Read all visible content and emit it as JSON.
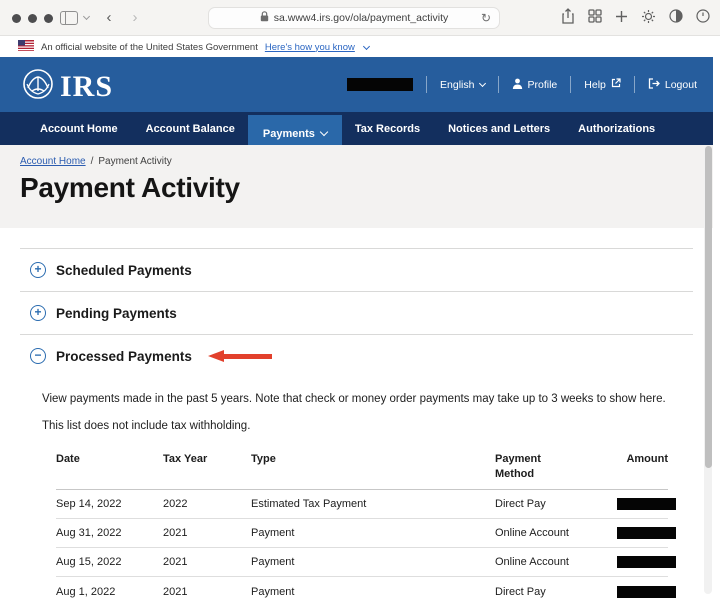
{
  "browser": {
    "url": "sa.www4.irs.gov/ola/payment_activity"
  },
  "gov_banner": {
    "text": "An official website of the United States Government",
    "link_label": "Here's how you know"
  },
  "header": {
    "logo_text": "IRS",
    "language_label": "English",
    "profile_label": "Profile",
    "help_label": "Help",
    "logout_label": "Logout"
  },
  "nav": {
    "active_item": "Payments",
    "items": [
      {
        "label": "Account Home"
      },
      {
        "label": "Account Balance"
      },
      {
        "label": "Payments"
      },
      {
        "label": "Tax Records"
      },
      {
        "label": "Notices and Letters"
      },
      {
        "label": "Authorizations"
      }
    ]
  },
  "breadcrumb": {
    "link": "Account Home",
    "separator": "/",
    "current": "Payment Activity"
  },
  "page": {
    "title": "Payment Activity"
  },
  "accordions": [
    {
      "label": "Scheduled Payments",
      "icon": "+",
      "state": "collapsed"
    },
    {
      "label": "Pending Payments",
      "icon": "+",
      "state": "collapsed"
    },
    {
      "label": "Processed Payments",
      "icon": "−",
      "state": "expanded"
    }
  ],
  "annotation": {
    "type": "red-arrow",
    "points_at": "Processed Payments"
  },
  "processed": {
    "description": "View payments made in the past 5 years. Note that check or money order payments may take up to 3 weeks to show here.",
    "note": "This list does not include tax withholding.",
    "table": {
      "columns": {
        "date": "Date",
        "tax_year": "Tax Year",
        "type": "Type",
        "method": "Payment Method",
        "amount": "Amount"
      },
      "rows": [
        {
          "date": "Sep 14, 2022",
          "tax_year": "2022",
          "type": "Estimated Tax Payment",
          "method": "Direct Pay",
          "amount_redacted": true
        },
        {
          "date": "Aug 31, 2022",
          "tax_year": "2021",
          "type": "Payment",
          "method": "Online Account",
          "amount_redacted": true
        },
        {
          "date": "Aug 15, 2022",
          "tax_year": "2021",
          "type": "Payment",
          "method": "Online Account",
          "amount_redacted": true
        },
        {
          "date": "Aug 1, 2022",
          "tax_year": "2021",
          "type": "Payment",
          "method": "Direct Pay",
          "amount_redacted": true
        }
      ]
    }
  },
  "colors": {
    "header_blue": "#265d9d",
    "nav_navy": "#132f5e",
    "active_tab_blue": "#2a68a9",
    "link_blue": "#2b5cb0",
    "accent_red": "#e2402c",
    "page_band_gray": "#f3f2f1",
    "redacted_black": "#050505"
  }
}
